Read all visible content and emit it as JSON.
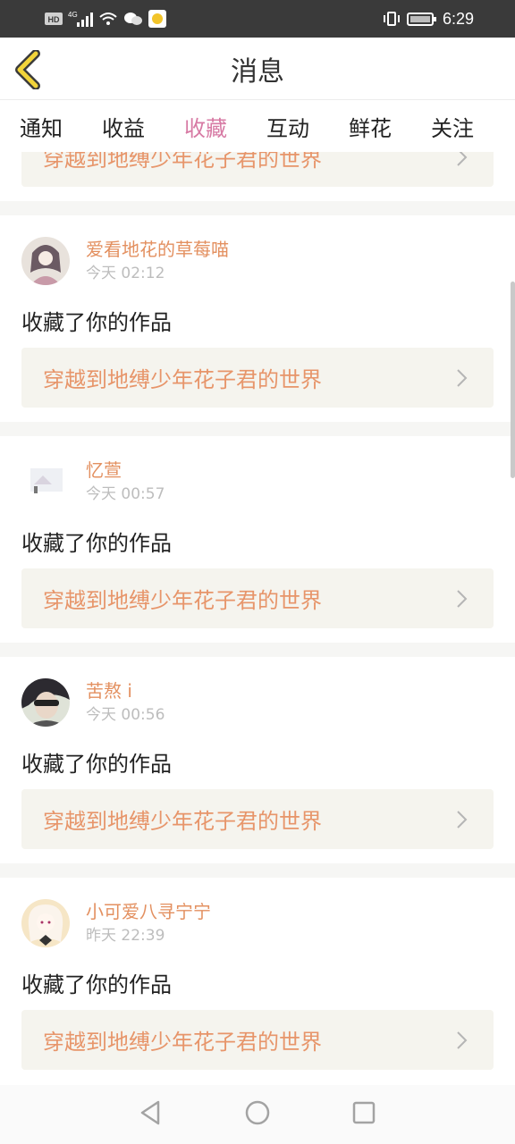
{
  "status_bar": {
    "left_badges": [
      "HD",
      "4G"
    ],
    "time": "6:29"
  },
  "header": {
    "title": "消息"
  },
  "tabs": [
    {
      "label": "通知",
      "active": false
    },
    {
      "label": "收益",
      "active": false
    },
    {
      "label": "收藏",
      "active": true
    },
    {
      "label": "互动",
      "active": false
    },
    {
      "label": "鲜花",
      "active": false
    },
    {
      "label": "关注",
      "active": false
    }
  ],
  "partial_item": {
    "work_title": "穿越到地缚少年花子君的世界"
  },
  "items": [
    {
      "user": "爱看地花的草莓喵",
      "time": "今天 02:12",
      "action": "收藏了你的作品",
      "work_title": "穿越到地缚少年花子君的世界"
    },
    {
      "user": "忆萱",
      "time": "今天 00:57",
      "action": "收藏了你的作品",
      "work_title": "穿越到地缚少年花子君的世界"
    },
    {
      "user": "苦熬 i",
      "time": "今天 00:56",
      "action": "收藏了你的作品",
      "work_title": "穿越到地缚少年花子君的世界"
    },
    {
      "user": "小可爱八寻宁宁",
      "time": "昨天 22:39",
      "action": "收藏了你的作品",
      "work_title": "穿越到地缚少年花子君的世界"
    }
  ],
  "colors": {
    "accent_pink": "#d77aa4",
    "name_orange": "#e39060",
    "link_orange": "#e7956a",
    "back_yellow": "#f2d43a"
  }
}
